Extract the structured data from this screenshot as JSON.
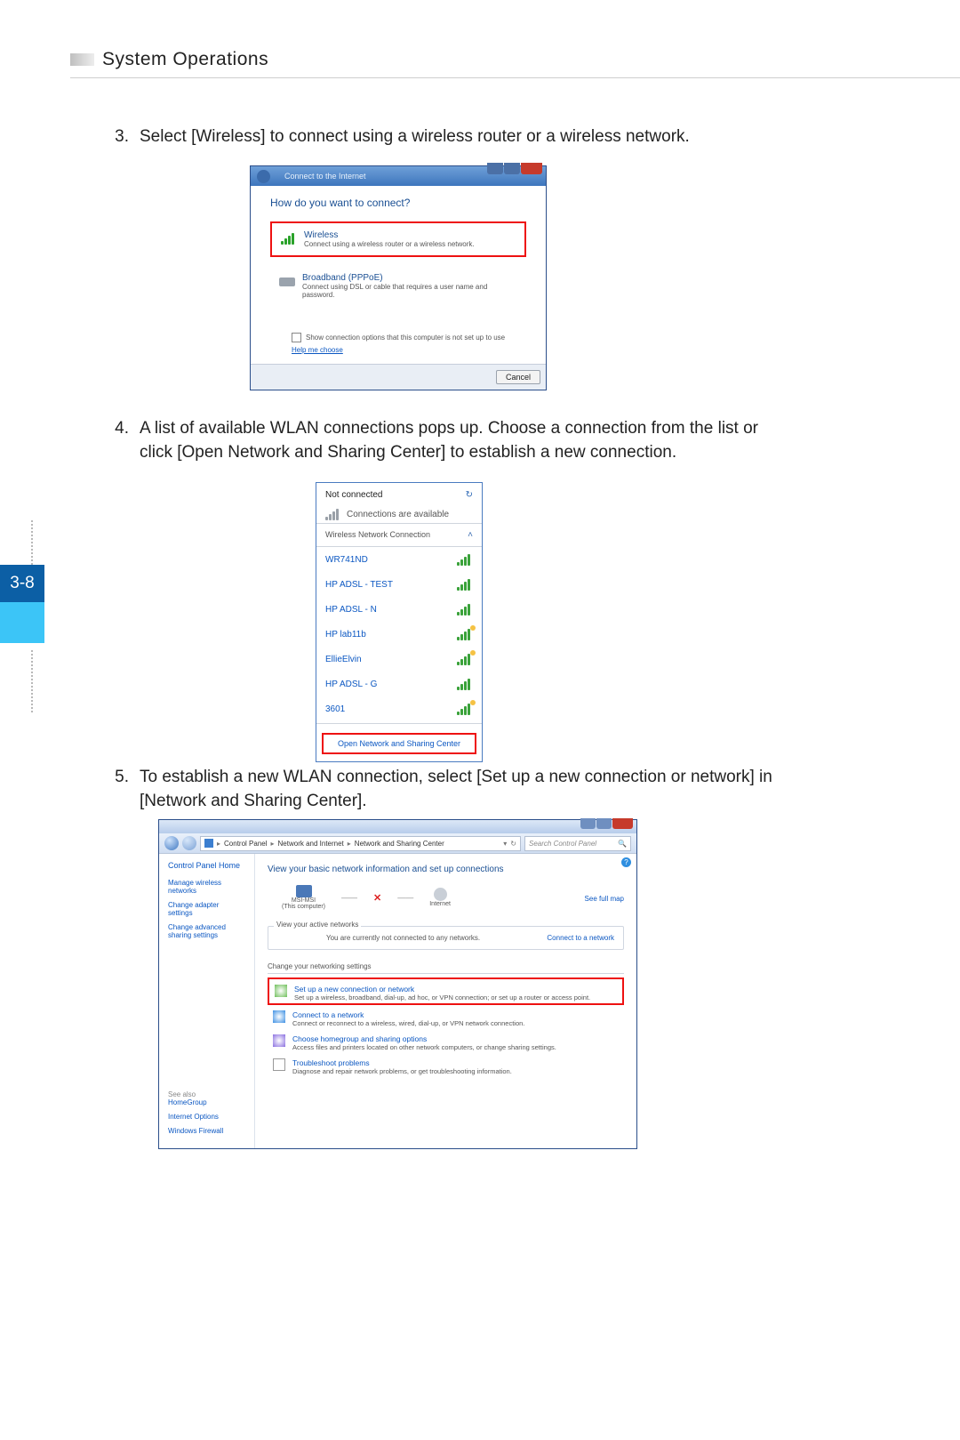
{
  "header": {
    "title": "System Operations"
  },
  "page_number": "3-8",
  "steps": {
    "s3": {
      "num": "3.",
      "text": "Select [Wireless] to connect using a wireless router or a wireless network."
    },
    "s4": {
      "num": "4.",
      "text": "A list of available WLAN connections pops up. Choose a connection from the list or click [Open Network and Sharing Center] to establish a new connection."
    },
    "s5": {
      "num": "5.",
      "text": "To establish a new WLAN connection, select [Set up a new connection or network] in [Network and Sharing Center]."
    }
  },
  "dialog1": {
    "title": "Connect to the Internet",
    "question": "How do you want to connect?",
    "wireless": {
      "title": "Wireless",
      "desc": "Connect using a wireless router or a wireless network."
    },
    "pppoe": {
      "title": "Broadband (PPPoE)",
      "desc": "Connect using DSL or cable that requires a user name and password."
    },
    "show_opts": "Show connection options that this computer is not set up to use",
    "help": "Help me choose",
    "cancel": "Cancel"
  },
  "popup": {
    "status": "Not connected",
    "avail": "Connections are available",
    "group": "Wireless Network Connection",
    "open_center": "Open Network and Sharing Center",
    "networks": [
      {
        "name": "WR741ND"
      },
      {
        "name": "HP ADSL - TEST"
      },
      {
        "name": "HP ADSL - N"
      },
      {
        "name": "HP lab11b"
      },
      {
        "name": "EllieElvin"
      },
      {
        "name": "HP ADSL - G"
      },
      {
        "name": "3601"
      }
    ]
  },
  "cp": {
    "breadcrumb": {
      "root": "Control Panel",
      "mid": "Network and Internet",
      "leaf": "Network and Sharing Center"
    },
    "search_placeholder": "Search Control Panel",
    "side": {
      "home": "Control Panel Home",
      "links": [
        "Manage wireless networks",
        "Change adapter settings",
        "Change advanced sharing settings"
      ],
      "see_also": "See also",
      "see_links": [
        "HomeGroup",
        "Internet Options",
        "Windows Firewall"
      ]
    },
    "main": {
      "heading": "View your basic network information and set up connections",
      "computer": "MSI-MSI",
      "computer_sub": "(This computer)",
      "internet": "Internet",
      "see_full": "See full map",
      "active_legend": "View your active networks",
      "active_msg": "You are currently not connected to any networks.",
      "connect_link": "Connect to a network",
      "change": "Change your networking settings",
      "tasks": {
        "setup": {
          "t": "Set up a new connection or network",
          "d": "Set up a wireless, broadband, dial-up, ad hoc, or VPN connection; or set up a router or access point."
        },
        "connect": {
          "t": "Connect to a network",
          "d": "Connect or reconnect to a wireless, wired, dial-up, or VPN network connection."
        },
        "home": {
          "t": "Choose homegroup and sharing options",
          "d": "Access files and printers located on other network computers, or change sharing settings."
        },
        "trouble": {
          "t": "Troubleshoot problems",
          "d": "Diagnose and repair network problems, or get troubleshooting information."
        }
      }
    }
  }
}
